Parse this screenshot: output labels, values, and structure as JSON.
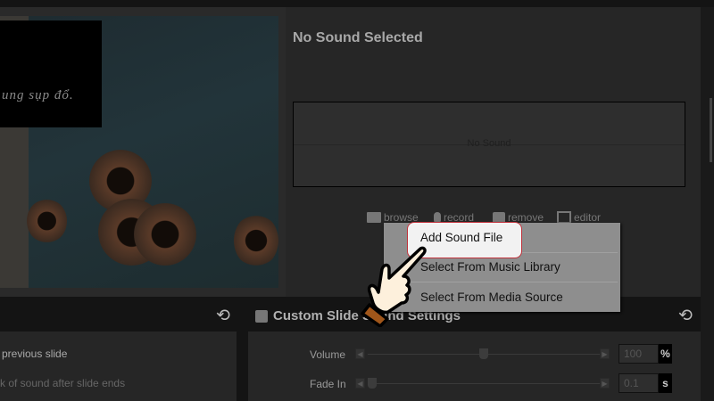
{
  "slide": {
    "caption": "ung sụp đổ."
  },
  "sound": {
    "title": "No Sound Selected",
    "waveform_text": "No Sound",
    "tools": [
      {
        "label": "browse",
        "icon": "folder-icon"
      },
      {
        "label": "record",
        "icon": "microphone-icon"
      },
      {
        "label": "remove",
        "icon": "trash-icon"
      },
      {
        "label": "editor",
        "icon": "editor-icon"
      }
    ]
  },
  "context_menu": {
    "items": [
      "Add Sound File",
      "Select From Music Library",
      "Select From Media Source"
    ],
    "highlighted": "Add Sound File"
  },
  "left_settings": {
    "option1": "previous slide",
    "option2": "k of sound after slide ends"
  },
  "custom_settings": {
    "label": "Custom Slide Sound Settings",
    "volume": {
      "label": "Volume",
      "value": "100",
      "unit": "%",
      "fraction": 0.5
    },
    "fade_in": {
      "label": "Fade In",
      "value": "0.1",
      "unit": "s",
      "fraction": 0.0
    }
  },
  "colors": {
    "highlight_border": "#c0303a",
    "panel": "#262626"
  }
}
